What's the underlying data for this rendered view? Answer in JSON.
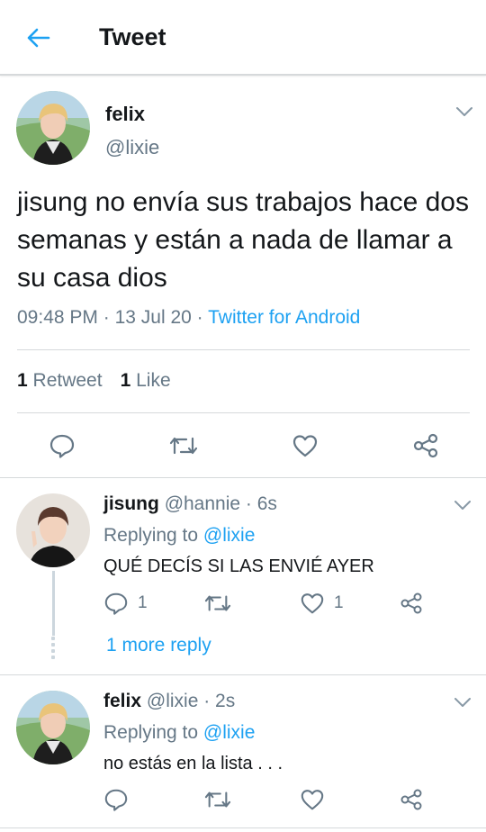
{
  "header": {
    "title": "Tweet",
    "back_icon": "arrow-left-icon"
  },
  "tweet": {
    "name": "felix",
    "handle": "@lixie",
    "text": "jisung no envía sus trabajos hace dos semanas y están a nada de llamar a su casa dios",
    "time": "09:48 PM",
    "date": "13 Jul 20",
    "sep": "·",
    "source": "Twitter for Android",
    "retweets_count": "1",
    "retweets_label": "Retweet",
    "likes_count": "1",
    "likes_label": "Like"
  },
  "replies": [
    {
      "name": "jisung",
      "handle": "@hannie",
      "time": "6s",
      "replying_label": "Replying to",
      "replying_to": "@lixie",
      "text": "QUÉ DECÍS SI LAS ENVIÉ AYER",
      "reply_count": "1",
      "retweet_count": "",
      "like_count": "1"
    },
    {
      "name": "felix",
      "handle": "@lixie",
      "time": "2s",
      "replying_label": "Replying to",
      "replying_to": "@lixie",
      "text": "no estás en la lista . . .",
      "reply_count": "",
      "retweet_count": "",
      "like_count": ""
    }
  ],
  "more_reply_label": "1 more reply",
  "colors": {
    "accent": "#1da1f2",
    "secondary": "#657786",
    "divider": "#d6d9db"
  }
}
